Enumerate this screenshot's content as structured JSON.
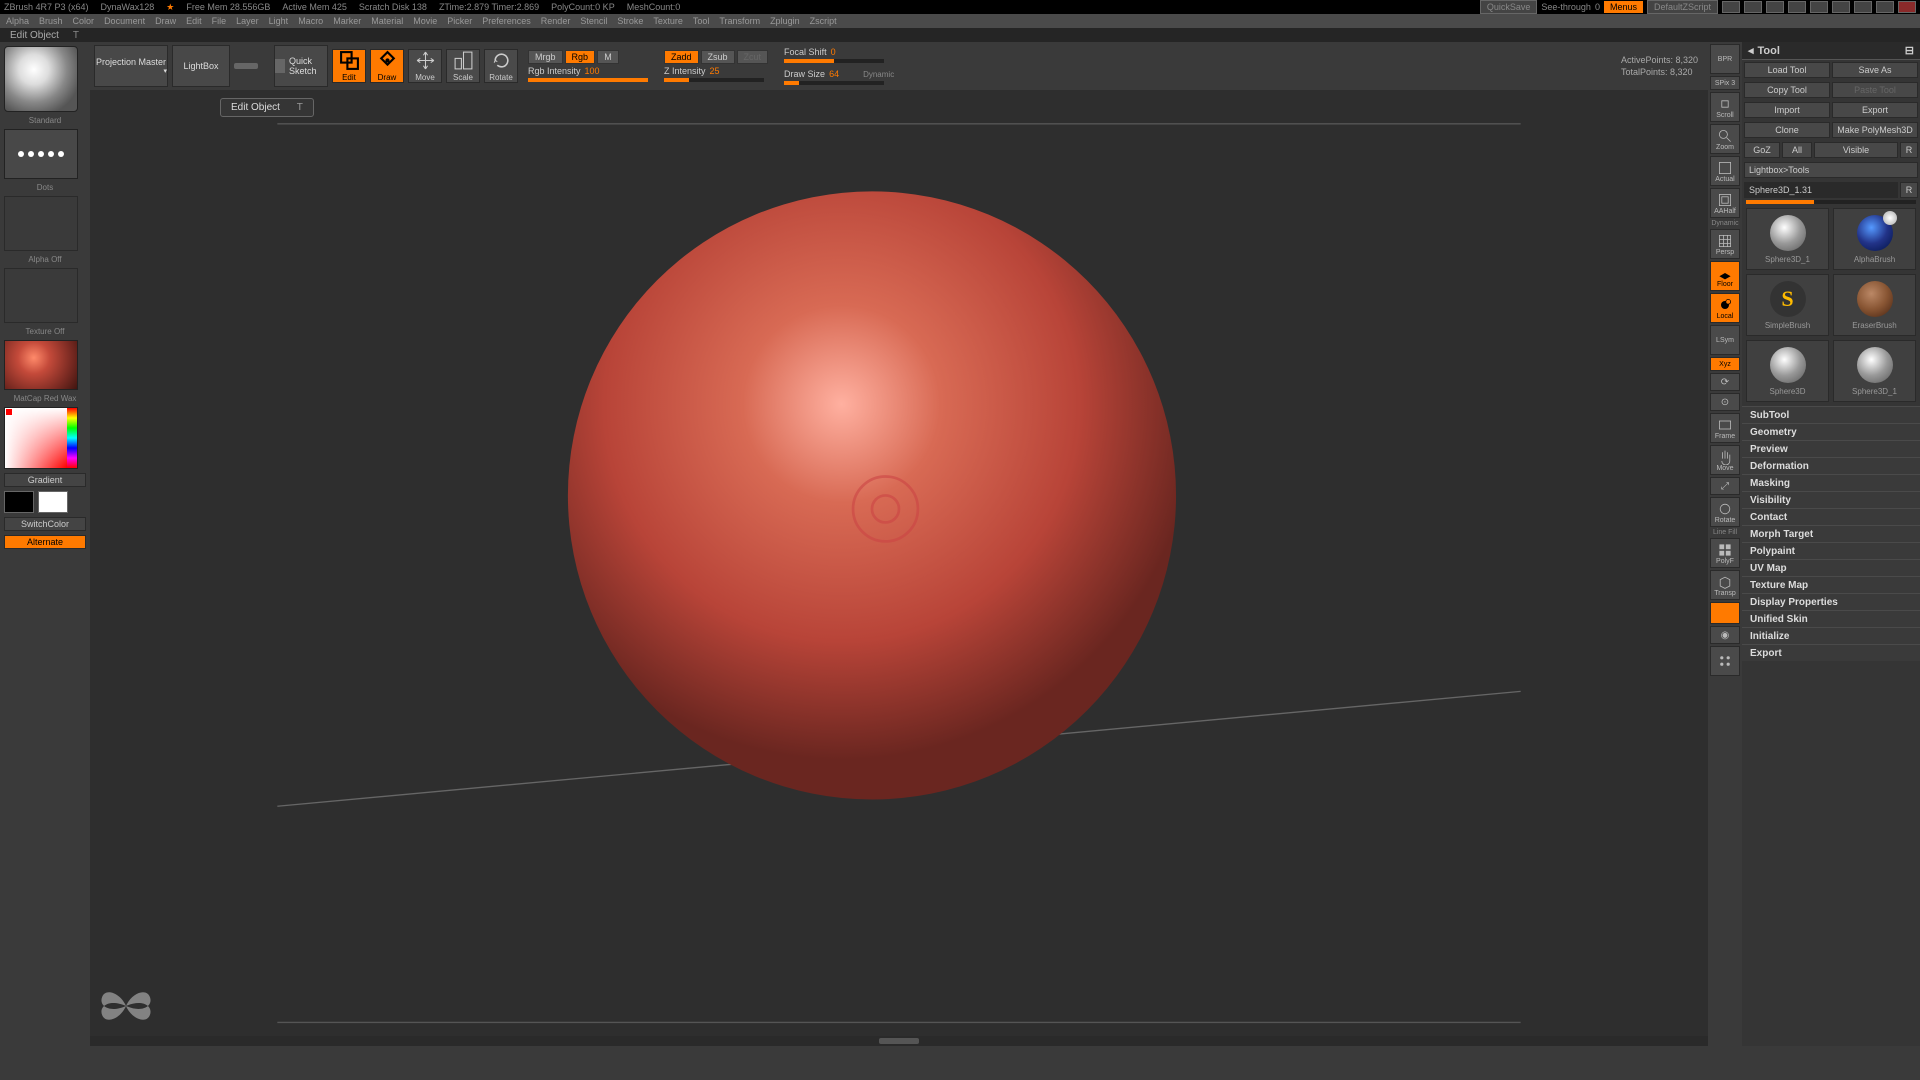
{
  "titlebar": {
    "segments": [
      "ZBrush 4R7 P3 (x64)",
      "DynaWax128",
      "",
      "Free Mem 28.556GB",
      "Active Mem 425",
      "Scratch Disk 138",
      "ZTime:2.879 Timer:2.869",
      "PolyCount:0 KP",
      "MeshCount:0"
    ],
    "quicksave": "QuickSave",
    "seethrough": "See-through",
    "seethrough_val": "0",
    "menus": "Menus",
    "layout_label": "DefaultZScript"
  },
  "menubar": [
    "Alpha",
    "Brush",
    "Color",
    "Document",
    "Draw",
    "Edit",
    "File",
    "Layer",
    "Light",
    "Macro",
    "Marker",
    "Material",
    "Movie",
    "Picker",
    "Preferences",
    "Render",
    "Stencil",
    "Stroke",
    "Texture",
    "Tool",
    "Transform",
    "Zplugin",
    "Zscript"
  ],
  "status": {
    "label": "Edit Object",
    "key": "T"
  },
  "tooltip": {
    "label": "Edit Object",
    "key": "T"
  },
  "toolbar": {
    "projection": "Projection Master",
    "lightbox": "LightBox",
    "quicksketch": "Quick Sketch",
    "edit": "Edit",
    "draw": "Draw",
    "move": "Move",
    "scale": "Scale",
    "rotate": "Rotate",
    "mrgb": "Mrgb",
    "rgb": "Rgb",
    "m": "M",
    "rgb_int_lbl": "Rgb Intensity",
    "rgb_int_val": "100",
    "zadd": "Zadd",
    "zsub": "Zsub",
    "zcut": "Zcut",
    "z_int_lbl": "Z Intensity",
    "z_int_val": "25",
    "focal_lbl": "Focal Shift",
    "focal_val": "0",
    "draw_size_lbl": "Draw Size",
    "draw_size_val": "64",
    "dynamic": "Dynamic",
    "active_pts": "ActivePoints: 8,320",
    "total_pts": "TotalPoints: 8,320"
  },
  "left": {
    "brush_label": "Standard",
    "stroke_label": "Dots",
    "alpha_label": "Alpha Off",
    "texture_label": "Texture Off",
    "material_label": "MatCap Red Wax",
    "gradient": "Gradient",
    "switchcolor": "SwitchColor",
    "alternate": "Alternate",
    "swatch1": "#000000",
    "swatch2": "#ffffff"
  },
  "sidebar": {
    "items": [
      "BPR",
      "SPix 3",
      "Scroll",
      "Zoom",
      "Actual",
      "AAHalf",
      "Persp",
      "Floor",
      "Local",
      "LSym",
      "Xyz",
      "Frame",
      "Move",
      "Rotate",
      "Line Fill",
      "PolyF",
      "Transp",
      "",
      "Solo",
      ""
    ],
    "dynamic_lbl": "Dynamic"
  },
  "tool": {
    "header": "Tool",
    "row1": [
      "Load Tool",
      "Save As"
    ],
    "row2": [
      "Copy Tool",
      "Paste Tool"
    ],
    "row3": [
      "Import",
      "Export"
    ],
    "row4": [
      "Clone",
      "Make PolyMesh3D"
    ],
    "row5": [
      "GoZ",
      "All",
      "Visible",
      "R"
    ],
    "lightbox_tools": "Lightbox>Tools",
    "current": "Sphere3D_1.31",
    "current_r": "R",
    "thumbs": [
      "Sphere3D_1",
      "AlphaBrush",
      "SimpleBrush",
      "EraserBrush",
      "Sphere3D",
      "Sphere3D_1"
    ],
    "accordion": [
      "SubTool",
      "Geometry",
      "Preview",
      "Deformation",
      "Masking",
      "Visibility",
      "Contact",
      "Morph Target",
      "Polypaint",
      "UV Map",
      "Texture Map",
      "Display Properties",
      "Unified Skin",
      "Initialize",
      "Export"
    ]
  }
}
